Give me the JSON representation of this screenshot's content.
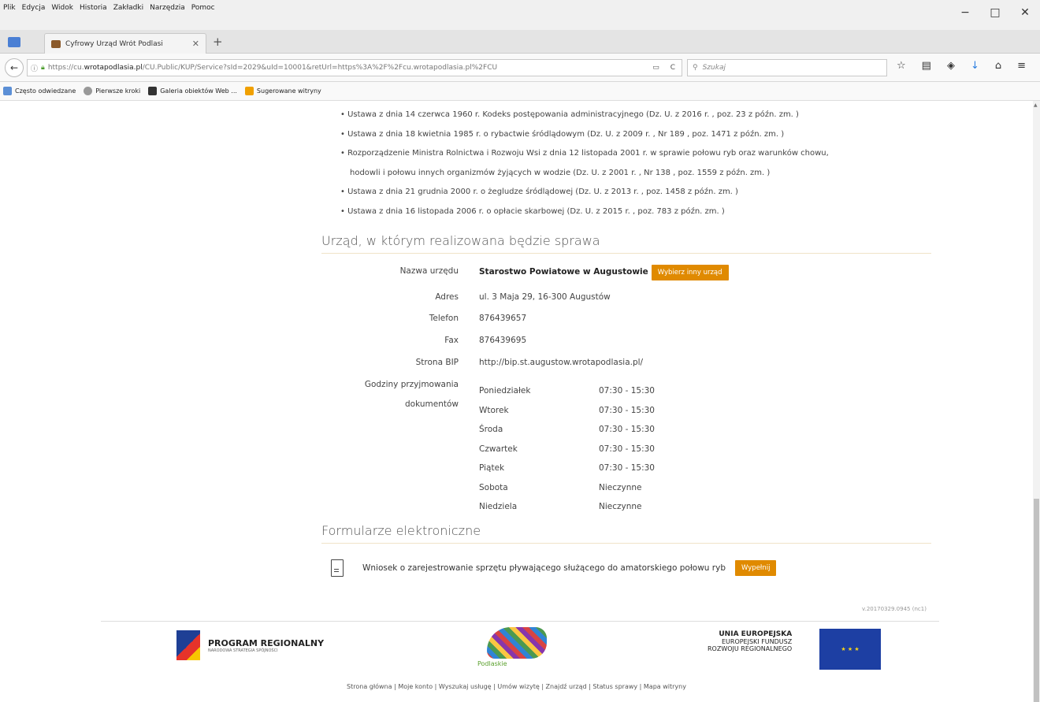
{
  "menu": {
    "items": [
      "Plik",
      "Edycja",
      "Widok",
      "Historia",
      "Zakładki",
      "Narzędzia",
      "Pomoc"
    ]
  },
  "window": {
    "minimize": "−",
    "maximize": "□",
    "close": "✕"
  },
  "tab": {
    "title": "Cyfrowy Urząd Wrót Podlasi",
    "close": "✕",
    "add": "+"
  },
  "nav": {
    "back": "←",
    "url_prefix": "https://cu.",
    "url_domain": "wrotapodlasia.pl",
    "url_rest": "/CU.Public/KUP/Service?sId=2029&uId=10001&retUrl=https%3A%2F%2Fcu.wrotapodlasia.pl%2FCU",
    "reload": "C",
    "search_placeholder": "Szukaj"
  },
  "bookmarks": [
    "Często odwiedzane",
    "Pierwsze kroki",
    "Galeria obiektów Web ...",
    "Sugerowane witryny"
  ],
  "laws": [
    "Ustawa z dnia 14 czerwca 1960 r. Kodeks postępowania administracyjnego (Dz. U. z 2016 r. , poz. 23 z późn. zm. )",
    "Ustawa z dnia 18 kwietnia 1985 r. o rybactwie śródlądowym (Dz. U. z 2009 r. , Nr 189 , poz. 1471 z późn. zm. )",
    "Rozporządzenie Ministra Rolnictwa i Rozwoju Wsi z dnia 12 listopada 2001 r. w sprawie połowu ryb oraz warunków chowu,",
    "hodowli i połowu innych organizmów żyjących w wodzie (Dz. U. z 2001 r. , Nr 138 , poz. 1559 z późn. zm. )",
    "Ustawa z dnia 21 grudnia 2000 r. o żegludze śródlądowej (Dz. U. z 2013 r. , poz. 1458 z późn. zm. )",
    "Ustawa z dnia 16 listopada 2006 r. o opłacie skarbowej (Dz. U. z 2015 r. , poz. 783 z późn. zm. )"
  ],
  "office_section": {
    "heading": "Urząd, w którym realizowana będzie sprawa",
    "name_label": "Nazwa urzędu",
    "name": "Starostwo Powiatowe w Augustowie",
    "change_button": "Wybierz inny urząd",
    "address_label": "Adres",
    "address": "ul. 3 Maja 29, 16-300 Augustów",
    "phone_label": "Telefon",
    "phone": "876439657",
    "fax_label": "Fax",
    "fax": "876439695",
    "bip_label": "Strona BIP",
    "bip": "http://bip.st.augustow.wrotapodlasia.pl/",
    "hours_label_1": "Godziny przyjmowania",
    "hours_label_2": "dokumentów",
    "hours": [
      {
        "day": "Poniedziałek",
        "time": "07:30  -  15:30"
      },
      {
        "day": "Wtorek",
        "time": "07:30  -  15:30"
      },
      {
        "day": "Środa",
        "time": "07:30  -  15:30"
      },
      {
        "day": "Czwartek",
        "time": "07:30  -  15:30"
      },
      {
        "day": "Piątek",
        "time": "07:30  -  15:30"
      },
      {
        "day": "Sobota",
        "time": "Nieczynne"
      },
      {
        "day": "Niedziela",
        "time": "Nieczynne"
      }
    ]
  },
  "forms_section": {
    "heading": "Formularze elektroniczne",
    "form_title": "Wniosek o zarejestrowanie sprzętu pływającego służącego do amatorskiego połowu ryb",
    "fill_button": "Wypełnij"
  },
  "version": "v.20170329.0945 (nc1)",
  "footer": {
    "program": "PROGRAM REGIONALNY",
    "program_sub": "NARODOWA STRATEGIA SPÓJNOŚCI",
    "podlaskie": "Podlaskie",
    "ue_1": "UNIA EUROPEJSKA",
    "ue_2": "EUROPEJSKI FUNDUSZ",
    "ue_3": "ROZWOJU REGIONALNEGO",
    "links": "Strona główna | Moje konto | Wyszukaj usługę | Umów wizytę | Znajdź urząd | Status sprawy | Mapa witryny"
  }
}
